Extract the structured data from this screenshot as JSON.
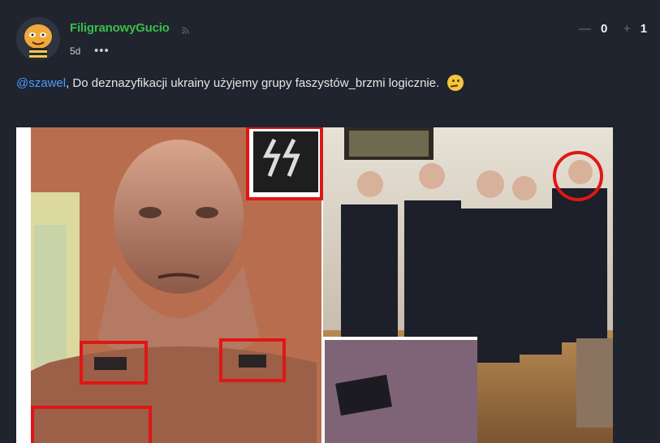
{
  "post": {
    "username": "FiligranowyGucio",
    "rss_icon": "rss-icon",
    "age": "5d",
    "more_label": "•••",
    "votes": {
      "minus_sign": "—",
      "minus_count": "0",
      "plus_sign": "+",
      "plus_count": "1"
    },
    "mention": "@szawel",
    "text": ", Do deznazyfikacji ukrainy użyjemy grupy faszystów_brzmi logicznie.",
    "emoji": "thinking-face-icon"
  },
  "colors": {
    "background": "#1f242e",
    "username": "#3bbd4a",
    "mention": "#4a9eff",
    "highlight_boxes": "#e01616"
  }
}
